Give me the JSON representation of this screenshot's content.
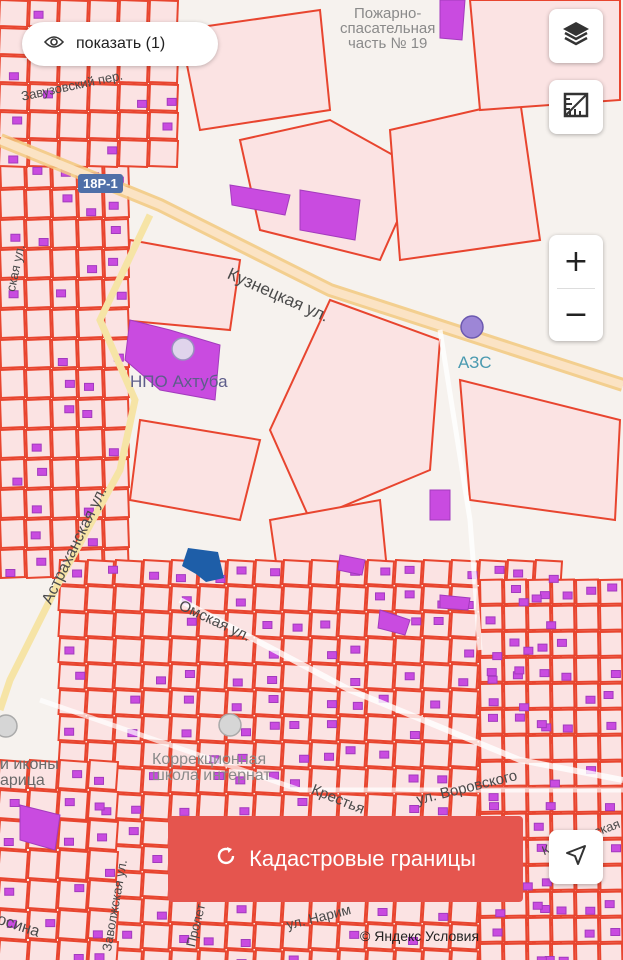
{
  "map": {
    "labels": {
      "fire_station": "Пожарно-\nспасательная\nчасть № 19",
      "kuznetskaya": "Кузнецкая ул.",
      "route": "18Р-1",
      "npo": "НПО Ахтуба",
      "azs": "АЗС",
      "astrakhanskaya": "Астраханская ул.",
      "omskaya": "Омская ул.",
      "school": "Коррекционная\nшкола интернат",
      "vorovskogo": "ул. Воровского",
      "krest": "Крестья",
      "krestyanskaya": "Крестьянская",
      "zavolzh": "Заволжская ул.",
      "sina": "осина",
      "icon_label": "и иконы\nарица",
      "narim": "ул. Нарим",
      "perv": "Пролет",
      "zavuz": "Завузовский пер.",
      "n": "ская ул."
    }
  },
  "controls": {
    "show_label": "показать (1)",
    "zoom_in": "+",
    "zoom_out": "−",
    "cadastral_label": "Кадастровые границы",
    "credit": "© Яндекс Условия"
  },
  "colors": {
    "parcel_fill": "#fbe3e3",
    "parcel_stroke": "#e8452f",
    "building": "#c94be0",
    "road_major": "#f2c97e",
    "button_red": "#e5554e"
  }
}
